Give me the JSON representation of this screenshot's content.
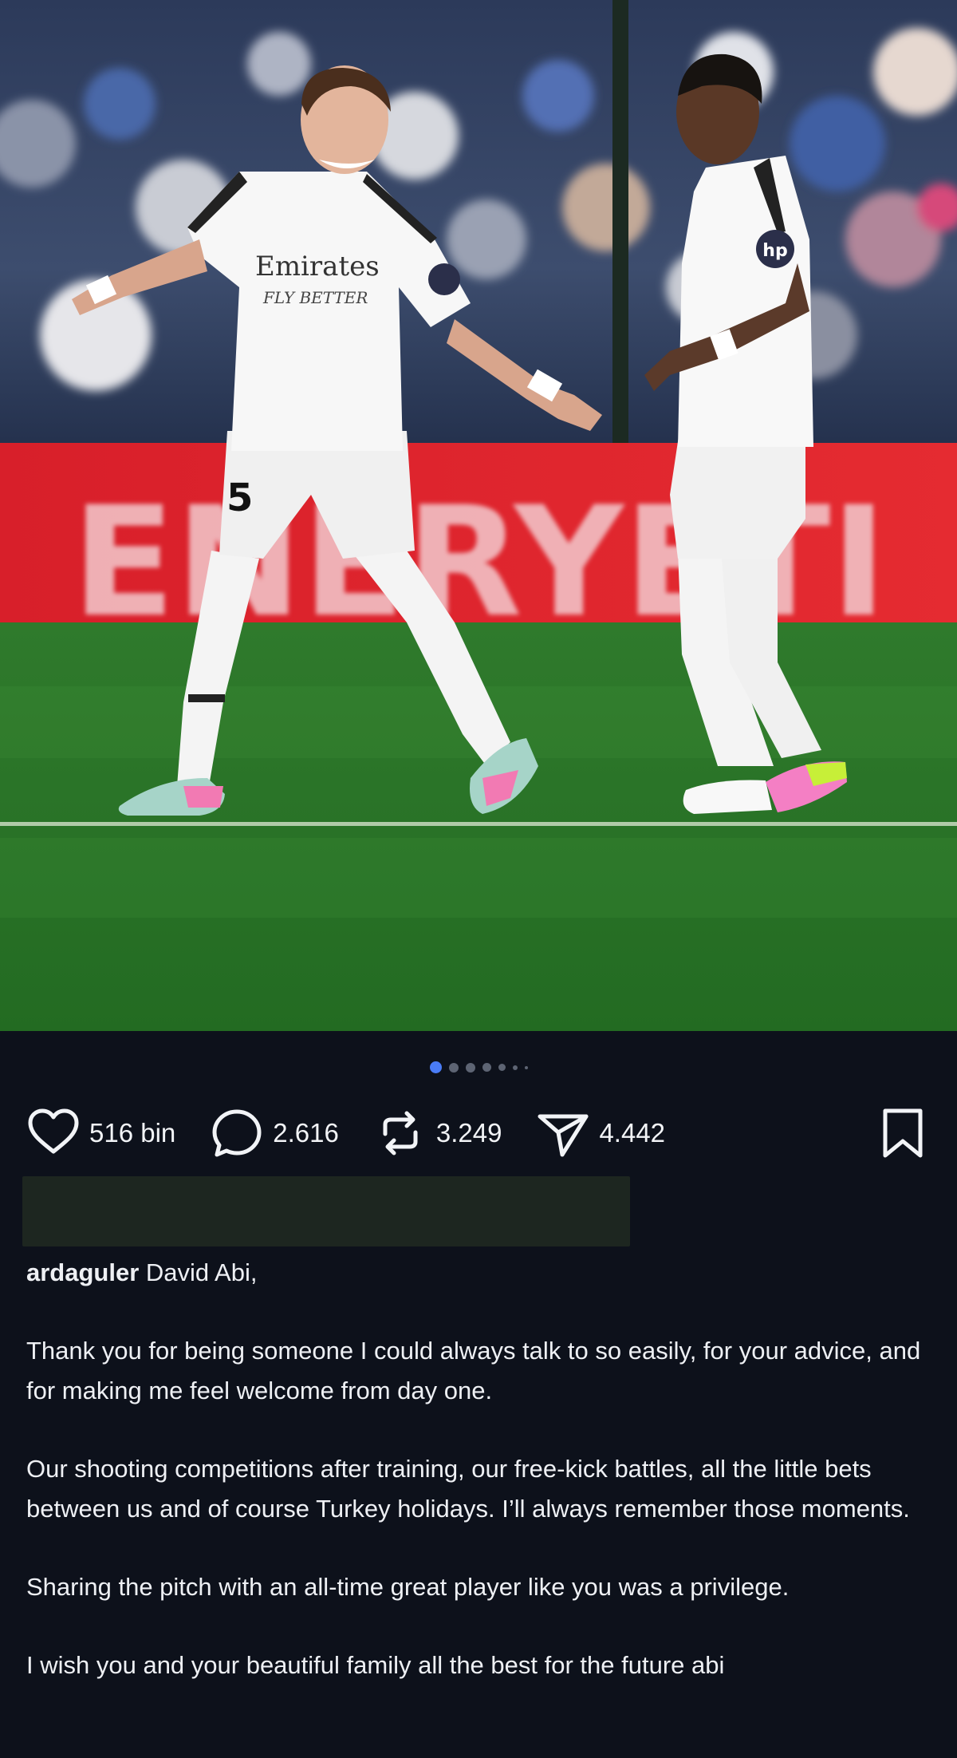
{
  "post": {
    "carousel": {
      "slides": 7,
      "active": 1
    },
    "actions": {
      "likes": "516 bin",
      "comments": "2.616",
      "reposts": "3.249",
      "shares": "4.442"
    },
    "icons": {
      "like": "heart-icon",
      "comment": "comment-bubble-icon",
      "repost": "repost-icon",
      "share": "send-icon",
      "save": "bookmark-icon"
    },
    "caption": {
      "username": "ardaguler",
      "first_line": " David Abi,",
      "paragraphs": [
        "Thank you for being someone I could always talk to so easily, for your advice, and for making me feel welcome from day one.",
        "Our shooting competitions after training, our free-kick battles, all the little bets between us and of course Turkey holidays. I’ll always remember those moments.",
        "Sharing the pitch with an all-time great player like you was a privilege.",
        "I wish you and your beautiful family all the best for the future abi"
      ]
    },
    "photo": {
      "board_text": "ENERYETI",
      "sponsor_text": "Emirates",
      "sponsor_sub": "FLY BETTER",
      "jersey_number": "5",
      "shirt_badge": "hp"
    }
  },
  "colors": {
    "background": "#0d111b",
    "active_dot": "#4a7cf6",
    "ad_board": "#e3232c",
    "pitch": "#2f7d2e"
  }
}
